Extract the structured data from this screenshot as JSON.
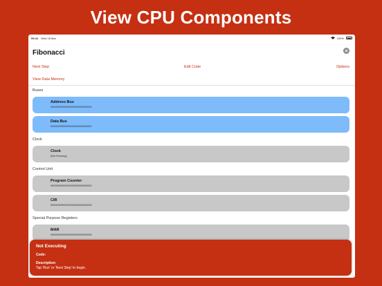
{
  "promo": {
    "title": "View CPU Components"
  },
  "status_bar": {
    "time": "09:41",
    "date": "Wed 18 Mar",
    "battery": "100%"
  },
  "nav": {
    "title": "Fibonacci"
  },
  "toolbar": {
    "next_step": "Next Step",
    "edit_code": "Edit Code",
    "options": "Options",
    "view_data_memory": "View Data Memory"
  },
  "sections": {
    "buses": {
      "header": "Buses",
      "items": [
        {
          "title": "Address Bus",
          "value": "0000000000000000000000000000"
        },
        {
          "title": "Data Bus",
          "value": "0000000000000000000000000000"
        }
      ]
    },
    "clock": {
      "header": "Clock",
      "items": [
        {
          "title": "Clock",
          "value": "(Not Running)"
        }
      ]
    },
    "control_unit": {
      "header": "Control Unit",
      "items": [
        {
          "title": "Program Counter",
          "value": "0000000000000000000000000000"
        },
        {
          "title": "CIR",
          "value": "0000000000000000000000000000"
        }
      ]
    },
    "special_registers": {
      "header": "Special Purpose Registers",
      "items": [
        {
          "title": "MAR",
          "value": "0000000000000000000000000000"
        }
      ]
    }
  },
  "execution": {
    "status": "Not Executing",
    "code_label": "Code:",
    "description_label": "Description:",
    "description": "Tap 'Run' or 'Next Step' to begin."
  },
  "colors": {
    "accent": "#c52f12",
    "bus_card": "#7ebbfb",
    "component_card": "#c8c8c8"
  }
}
